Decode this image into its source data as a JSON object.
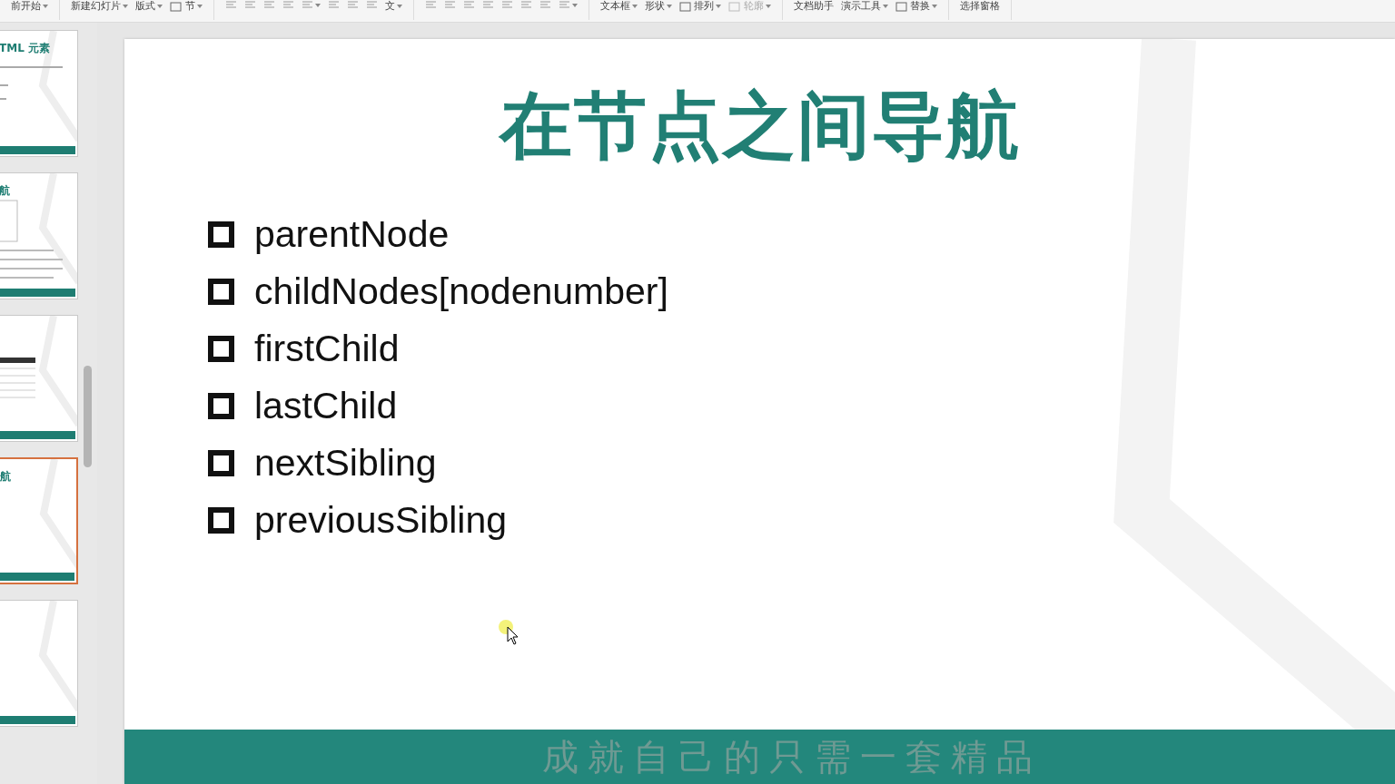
{
  "toolbar": {
    "groups": [
      {
        "items": [
          {
            "kind": "label",
            "label": "前开始",
            "dropdown": true
          }
        ]
      },
      {
        "items": [
          {
            "kind": "label",
            "label": "新建幻灯片",
            "dropdown": true
          },
          {
            "kind": "label",
            "label": "版式",
            "dropdown": true
          },
          {
            "kind": "icon-label",
            "label": "节",
            "dropdown": true
          }
        ]
      },
      {
        "items": [
          {
            "kind": "icon",
            "dropdown": false
          },
          {
            "kind": "icon",
            "dropdown": false
          },
          {
            "kind": "icon",
            "dropdown": false
          },
          {
            "kind": "icon",
            "dropdown": false
          },
          {
            "kind": "icon",
            "dropdown": true
          },
          {
            "kind": "icon",
            "dropdown": false
          },
          {
            "kind": "icon",
            "dropdown": false
          },
          {
            "kind": "icon",
            "dropdown": false
          },
          {
            "kind": "label",
            "label": "文",
            "dropdown": true
          }
        ]
      },
      {
        "items": [
          {
            "kind": "icon",
            "dropdown": false
          },
          {
            "kind": "icon",
            "dropdown": false
          },
          {
            "kind": "icon",
            "dropdown": false
          },
          {
            "kind": "icon",
            "dropdown": false
          },
          {
            "kind": "icon",
            "dropdown": false
          },
          {
            "kind": "icon",
            "dropdown": false
          },
          {
            "kind": "icon",
            "dropdown": false
          },
          {
            "kind": "icon",
            "dropdown": true
          }
        ]
      },
      {
        "items": [
          {
            "kind": "label",
            "label": "文本框",
            "dropdown": true
          },
          {
            "kind": "label",
            "label": "形状",
            "dropdown": true
          },
          {
            "kind": "icon-label",
            "label": "排列",
            "dropdown": true
          },
          {
            "kind": "icon-label",
            "label": "轮廓",
            "dropdown": true,
            "disabled": true
          }
        ]
      },
      {
        "items": [
          {
            "kind": "label",
            "label": "文档助手",
            "dropdown": false
          },
          {
            "kind": "label",
            "label": "演示工具",
            "dropdown": true
          },
          {
            "kind": "icon-label",
            "label": "替换",
            "dropdown": true
          }
        ]
      },
      {
        "items": [
          {
            "kind": "label",
            "label": "选择窗格",
            "dropdown": false
          }
        ]
      }
    ]
  },
  "thumbnails": [
    {
      "title": "TML 元素",
      "kind": "text",
      "selected": false
    },
    {
      "title": "航",
      "kind": "diagram",
      "selected": false
    },
    {
      "kind": "table",
      "selected": false
    },
    {
      "title": "航",
      "kind": "blank",
      "selected": true
    },
    {
      "kind": "blank",
      "selected": false
    }
  ],
  "slide": {
    "title": "在节点之间导航",
    "bullets": [
      "parentNode",
      "childNodes[nodenumber]",
      "firstChild",
      "lastChild",
      "nextSibling",
      "previousSibling"
    ],
    "footer": "成就自己的只需一套精品"
  }
}
